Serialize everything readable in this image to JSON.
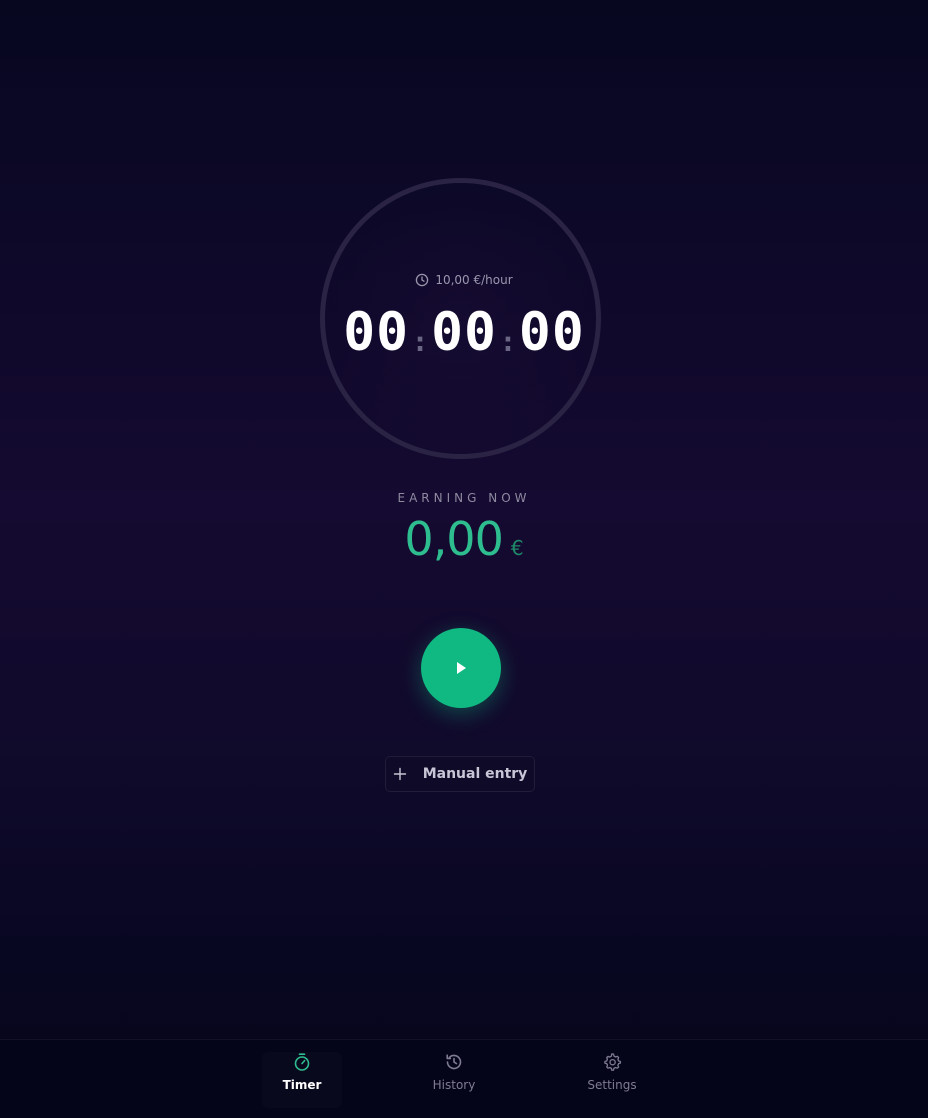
{
  "timer": {
    "rate_text": "10,00 €/hour",
    "hours": "00",
    "minutes": "00",
    "seconds": "00",
    "separator": ":"
  },
  "earnings": {
    "label": "EARNING NOW",
    "amount": "0,00",
    "currency": "€"
  },
  "controls": {
    "play_icon": "play-icon",
    "manual_entry_label": "Manual entry",
    "manual_entry_icon": "plus-icon"
  },
  "nav": {
    "items": [
      {
        "label": "Timer",
        "icon": "stopwatch-icon",
        "active": true
      },
      {
        "label": "History",
        "icon": "history-icon",
        "active": false
      },
      {
        "label": "Settings",
        "icon": "gear-icon",
        "active": false
      }
    ]
  },
  "colors": {
    "accent": "#10b981",
    "amount_text": "#2ebd8f",
    "background": "#0d0828"
  }
}
